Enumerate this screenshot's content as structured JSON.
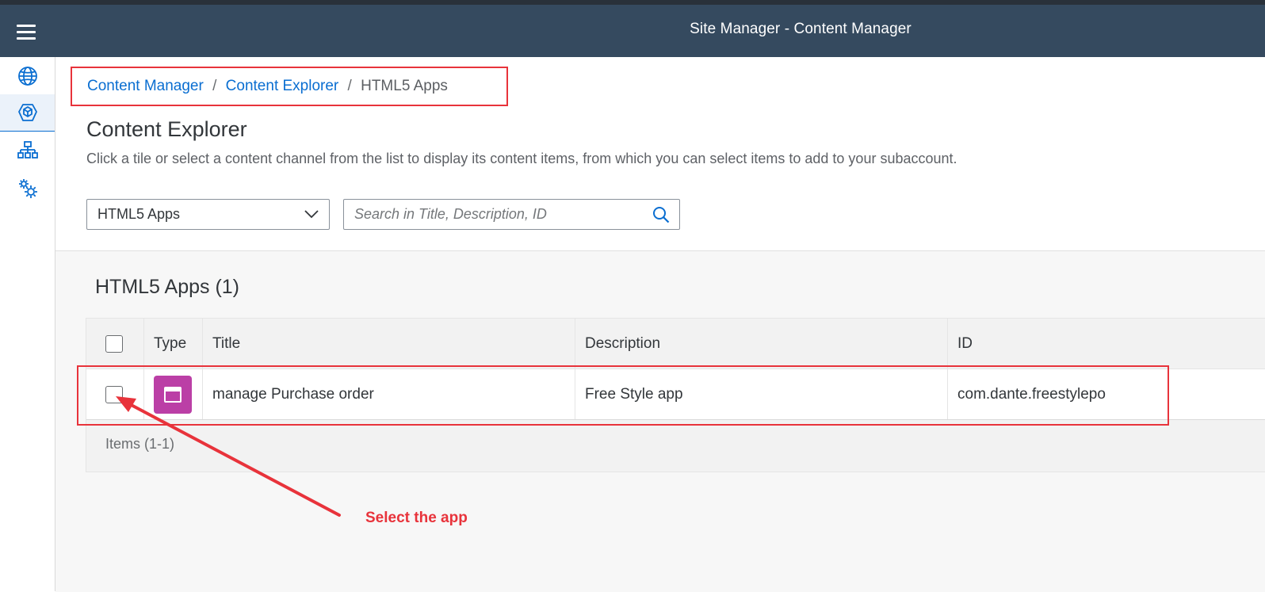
{
  "shell": {
    "title": "Site Manager - Content Manager",
    "menu_icon": "hamburger-menu-icon",
    "bar_color": "#354a5f"
  },
  "sidenav": {
    "items": [
      {
        "icon": "globe-icon",
        "selected": false
      },
      {
        "icon": "content-package-icon",
        "selected": true
      },
      {
        "icon": "site-hierarchy-icon",
        "selected": false
      },
      {
        "icon": "settings-gears-icon",
        "selected": false
      }
    ]
  },
  "breadcrumb": {
    "items": [
      "Content Manager",
      "Content Explorer"
    ],
    "current": "HTML5 Apps",
    "separator": "/"
  },
  "page": {
    "title": "Content Explorer",
    "description": "Click a tile or select a content channel from the list to display its content items, from which you can select items to add to your subaccount."
  },
  "filters": {
    "channel_select": {
      "value": "HTML5 Apps",
      "icon": "chevron-down-icon"
    },
    "search": {
      "placeholder": "Search in Title, Description, ID",
      "value": "",
      "icon": "search-icon"
    }
  },
  "table": {
    "title": "HTML5 Apps (1)",
    "columns": [
      "Type",
      "Title",
      "Description",
      "ID"
    ],
    "rows": [
      {
        "type_icon": "html5-app-tile-icon",
        "type_color": "#bb3fa6",
        "title": "manage Purchase order",
        "description": "Free Style app",
        "id": "com.dante.freestylepo",
        "selected": false
      }
    ],
    "footer": "Items (1-1)"
  },
  "annotation": {
    "text": "Select the app",
    "color": "#e8333b"
  }
}
